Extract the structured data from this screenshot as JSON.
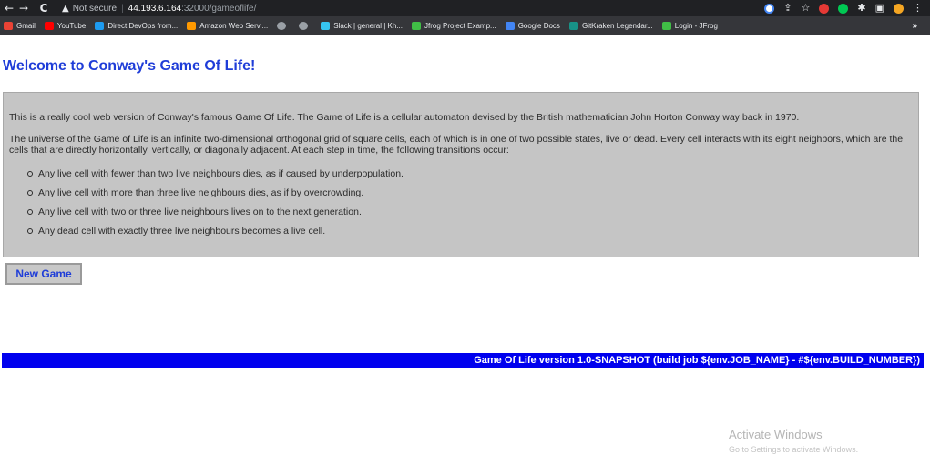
{
  "browser": {
    "security_label": "Not secure",
    "separator": "|",
    "url_host": "44.193.6.164",
    "url_rest": ":32000/gameoflife/"
  },
  "bookmarks": [
    {
      "label": "Gmail",
      "icon": "gmail-icon",
      "color": "#ea4335"
    },
    {
      "label": "YouTube",
      "icon": "youtube-icon",
      "color": "#ff0000"
    },
    {
      "label": "Direct DevOps from...",
      "icon": "devops-icon",
      "color": "#1d9bf0"
    },
    {
      "label": "Amazon Web Servi...",
      "icon": "aws-icon",
      "color": "#ff9900"
    },
    {
      "label": "",
      "icon": "globe-icon",
      "color": "#9aa0a6"
    },
    {
      "label": "",
      "icon": "globe-icon",
      "color": "#9aa0a6"
    },
    {
      "label": "Slack | general | Kh...",
      "icon": "slack-icon",
      "color": "#36c5f0"
    },
    {
      "label": "Jfrog Project Examp...",
      "icon": "jfrog-icon",
      "color": "#40be46"
    },
    {
      "label": "Google Docs",
      "icon": "google-docs-icon",
      "color": "#4285f4"
    },
    {
      "label": "GitKraken Legendar...",
      "icon": "gitkraken-icon",
      "color": "#179287"
    },
    {
      "label": "Login - JFrog",
      "icon": "jfrog-login-icon",
      "color": "#40be46"
    }
  ],
  "bookmarks_more": "»",
  "page": {
    "title": "Welcome to Conway's Game Of Life!",
    "intro": "This is a really cool web version of Conway's famous Game Of Life. The Game of Life is a cellular automaton devised by the British mathematician John Horton Conway way back in 1970.",
    "description": "The universe of the Game of Life is an infinite two-dimensional orthogonal grid of square cells, each of which is in one of two possible states, live or dead. Every cell interacts with its eight neighbors, which are the cells that are directly horizontally, vertically, or diagonally adjacent. At each step in time, the following transitions occur:",
    "rules": [
      "Any live cell with fewer than two live neighbours dies, as if caused by underpopulation.",
      "Any live cell with more than three live neighbours dies, as if by overcrowding.",
      "Any live cell with two or three live neighbours lives on to the next generation.",
      "Any dead cell with exactly three live neighbours becomes a live cell."
    ],
    "new_game_label": "New Game",
    "footer_text": "Game Of Life version 1.0-SNAPSHOT (build job ${env.JOB_NAME} - #${env.BUILD_NUMBER})"
  },
  "watermark": {
    "title": "Activate Windows",
    "subtitle": "Go to Settings to activate Windows."
  },
  "colors": {
    "title_blue": "#1f3dd8",
    "footer_blue": "#0000ee",
    "info_box_bg": "#c5c5c5"
  }
}
